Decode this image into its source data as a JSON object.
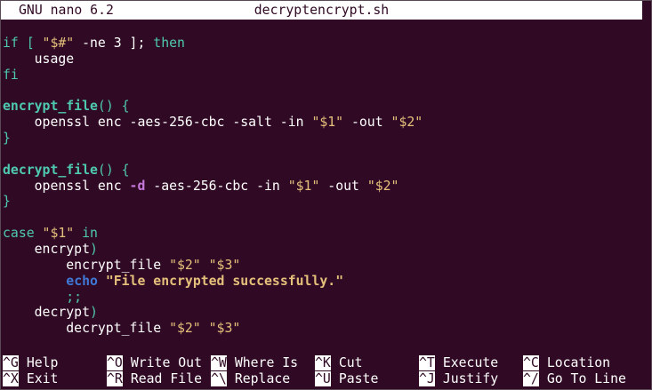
{
  "app": {
    "version": "GNU nano 6.2",
    "filename": "decryptencrypt.sh"
  },
  "code": {
    "l1": {
      "a": "if [ ",
      "b": "\"$#\"",
      "c": " -ne 3 ]; ",
      "d": "then"
    },
    "l2": {
      "a": "    usage"
    },
    "l3": {
      "a": "fi"
    },
    "l4": {
      "a": ""
    },
    "l5": {
      "a": "encrypt_file",
      "b": "() {"
    },
    "l6": {
      "a": "    openssl enc -aes-256-cbc -salt -in ",
      "b": "\"$1\"",
      "c": " -out ",
      "d": "\"$2\""
    },
    "l7": {
      "a": "}"
    },
    "l8": {
      "a": ""
    },
    "l9": {
      "a": "decrypt_file",
      "b": "() {"
    },
    "l10": {
      "a": "    openssl enc ",
      "b": "-d",
      "c": " -aes-256-cbc -in ",
      "d": "\"$1\"",
      "e": " -out ",
      "f": "\"$2\""
    },
    "l11": {
      "a": "}"
    },
    "l12": {
      "a": ""
    },
    "l13": {
      "a": "case ",
      "b": "\"$1\"",
      "c": " in"
    },
    "l14": {
      "a": "    encrypt",
      "b": ")"
    },
    "l15": {
      "a": "        encrypt_file ",
      "b": "\"$2\"",
      "c": " ",
      "d": "\"$3\""
    },
    "l16": {
      "a": "        ",
      "b": "echo",
      "c": " ",
      "d": "\"File encrypted successfully.\""
    },
    "l17": {
      "a": "        ;;"
    },
    "l18": {
      "a": "    decrypt",
      "b": ")"
    },
    "l19": {
      "a": "        decrypt_file ",
      "b": "\"$2\"",
      "c": " ",
      "d": "\"$3\""
    }
  },
  "shortcuts": {
    "row1": [
      {
        "key": "^G",
        "label": "Help"
      },
      {
        "key": "^O",
        "label": "Write Out"
      },
      {
        "key": "^W",
        "label": "Where Is"
      },
      {
        "key": "^K",
        "label": "Cut"
      },
      {
        "key": "^T",
        "label": "Execute"
      },
      {
        "key": "^C",
        "label": "Location"
      }
    ],
    "row2": [
      {
        "key": "^X",
        "label": "Exit"
      },
      {
        "key": "^R",
        "label": "Read File"
      },
      {
        "key": "^\\",
        "label": "Replace"
      },
      {
        "key": "^U",
        "label": "Paste"
      },
      {
        "key": "^J",
        "label": "Justify"
      },
      {
        "key": "^/",
        "label": "Go To Line"
      }
    ]
  },
  "colors": {
    "background": "#300a24",
    "keyword": "#4ec9b0",
    "string": "#e5c07b",
    "flag": "#c678dd",
    "builtin": "#3f78d6"
  }
}
